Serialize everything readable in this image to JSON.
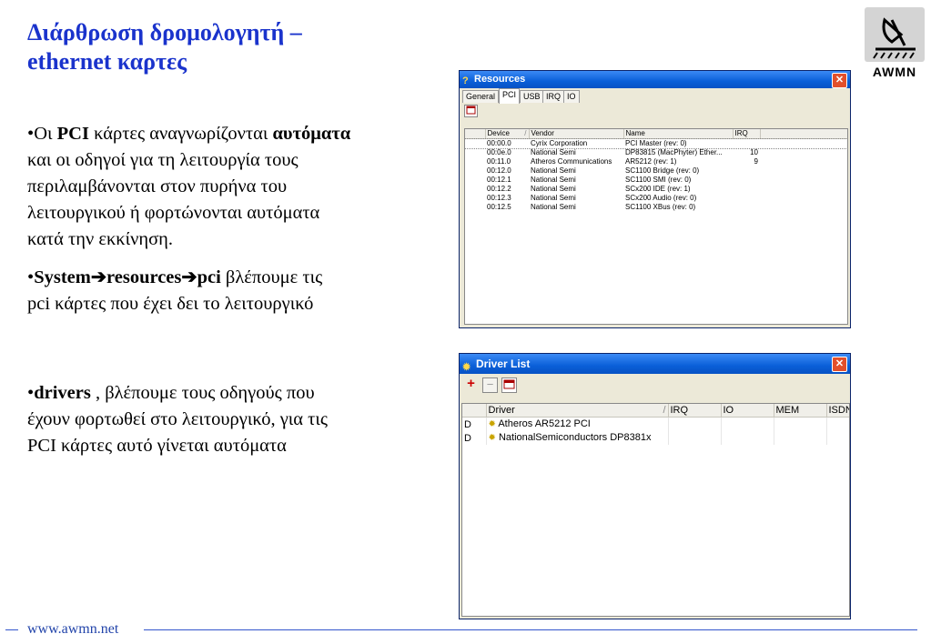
{
  "slide": {
    "title_line1": "Διάρθρωση δρομολογητή –",
    "title_line2": "ethernet καρτες",
    "bullet1": {
      "bullet": "•",
      "t1": "Οι ",
      "b1": "PCI",
      "t2": " κάρτες αναγνωρίζονται ",
      "b2": "αυτόματα",
      "line2": "και οι οδηγοί για τη λειτουργία τους",
      "line3": "περιλαμβάνονται στον πυρήνα του",
      "line4": "λειτουργικού ή φορτώνονται αυτόματα",
      "line5": "κατά την εκκίνηση."
    },
    "bullet2": {
      "bullet": "•",
      "b1": "System",
      "arrow": "➔",
      "b2": "resources",
      "b3": "pci",
      "t1": " βλέπουμε τις",
      "line2": "pci κάρτες που έχει δει το λειτουργικό"
    },
    "bullet3": {
      "bullet": "•",
      "b1": "drivers",
      "t1": " , βλέπουμε τους οδηγούς που",
      "line2": "έχουν φορτωθεί στο λειτουργικό, για τις",
      "line3": "PCI κάρτες αυτό γίνεται αυτόματα"
    },
    "logo_text": "AWMN",
    "footer_url": "www.awmn.net"
  },
  "resources_window": {
    "title": "Resources",
    "title_icon": "question-icon",
    "close": "✕",
    "tabs": [
      "General",
      "PCI",
      "USB",
      "IRQ",
      "IO"
    ],
    "active_tab": "PCI",
    "columns": [
      "Device",
      "Vendor",
      "Name",
      "IRQ"
    ],
    "sort_indicator": "/",
    "rows": [
      [
        "00:00.0",
        "Cyrix Corporation",
        "PCI Master (rev: 0)",
        ""
      ],
      [
        "00:0e.0",
        "National Semi",
        "DP83815 (MacPhyter) Ether...",
        "10"
      ],
      [
        "00:11.0",
        "Atheros Communications",
        "AR5212 (rev: 1)",
        "9"
      ],
      [
        "00:12.0",
        "National Semi",
        "SC1100 Bridge (rev: 0)",
        ""
      ],
      [
        "00:12.1",
        "National Semi",
        "SC1100 SMI (rev: 0)",
        ""
      ],
      [
        "00:12.2",
        "National Semi",
        "SCx200 IDE (rev: 1)",
        ""
      ],
      [
        "00:12.3",
        "National Semi",
        "SCx200 Audio (rev: 0)",
        ""
      ],
      [
        "00:12.5",
        "National Semi",
        "SC1100 XBus (rev: 0)",
        ""
      ]
    ]
  },
  "driver_window": {
    "title": "Driver List",
    "title_icon": "gear-icon",
    "close": "✕",
    "add": "+",
    "remove": "−",
    "columns": [
      "Driver",
      "IRQ",
      "IO",
      "MEM",
      "ISDN"
    ],
    "sort_indicator": "/",
    "rows": [
      [
        "D",
        "Atheros AR5212 PCI"
      ],
      [
        "D",
        "NationalSemiconductors DP8381x"
      ]
    ],
    "colors": {
      "add": "#cc0000",
      "remove": "#999999"
    }
  }
}
